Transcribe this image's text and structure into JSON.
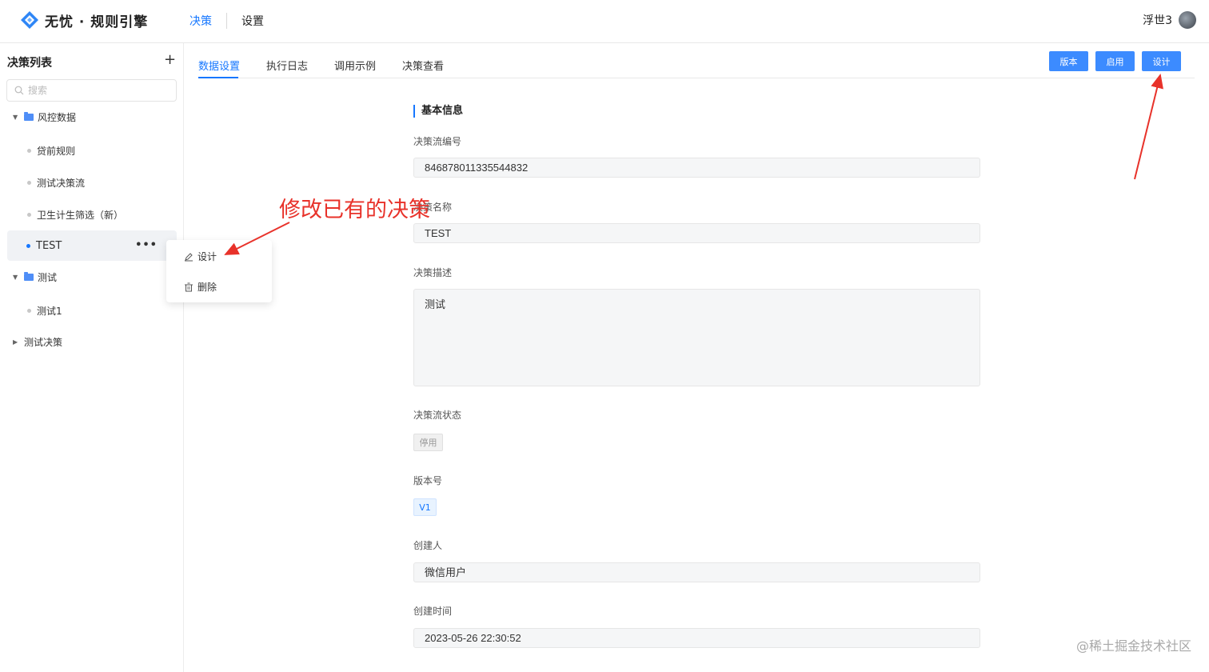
{
  "app": {
    "logo_text": "无忧 · 规则引擎",
    "nav": [
      {
        "label": "决策",
        "active": true
      },
      {
        "label": "设置",
        "active": false
      }
    ],
    "user_name": "浮世3"
  },
  "sidebar": {
    "title": "决策列表",
    "add_label": "+",
    "search_placeholder": "搜索",
    "tree": [
      {
        "label": "风控数据",
        "type": "folder",
        "expanded": true
      },
      {
        "label": "贷前规则",
        "type": "item"
      },
      {
        "label": "测试决策流",
        "type": "item"
      },
      {
        "label": "卫生计生筛选（新）",
        "type": "item"
      },
      {
        "label": "TEST",
        "type": "item",
        "selected": true
      },
      {
        "label": "测试",
        "type": "folder",
        "expanded": true
      },
      {
        "label": "测试1",
        "type": "item"
      },
      {
        "label": "测试决策",
        "type": "folder",
        "expanded": false
      }
    ],
    "more_label": "•••",
    "context_menu": [
      {
        "label": "设计",
        "icon": "edit-icon"
      },
      {
        "label": "删除",
        "icon": "trash-icon"
      }
    ]
  },
  "tabs": [
    {
      "label": "数据设置",
      "active": true
    },
    {
      "label": "执行日志"
    },
    {
      "label": "调用示例"
    },
    {
      "label": "决策查看"
    }
  ],
  "actions": {
    "version": "版本",
    "enable": "启用",
    "design": "设计"
  },
  "form": {
    "section_title": "基本信息",
    "flow_id_label": "决策流编号",
    "flow_id_value": "846878011335544832",
    "name_label": "决策名称",
    "name_value": "TEST",
    "desc_label": "决策描述",
    "desc_value": "测试",
    "status_label": "决策流状态",
    "status_value": "停用",
    "version_label": "版本号",
    "version_value": "V1",
    "creator_label": "创建人",
    "creator_value": "微信用户",
    "created_label": "创建时间",
    "created_value": "2023-05-26 22:30:52"
  },
  "annotation": "修改已有的决策",
  "watermark": "@稀土掘金技术社区",
  "colors": {
    "accent": "#1677ff",
    "button": "#3c8bff",
    "annotation": "#e8322a"
  }
}
